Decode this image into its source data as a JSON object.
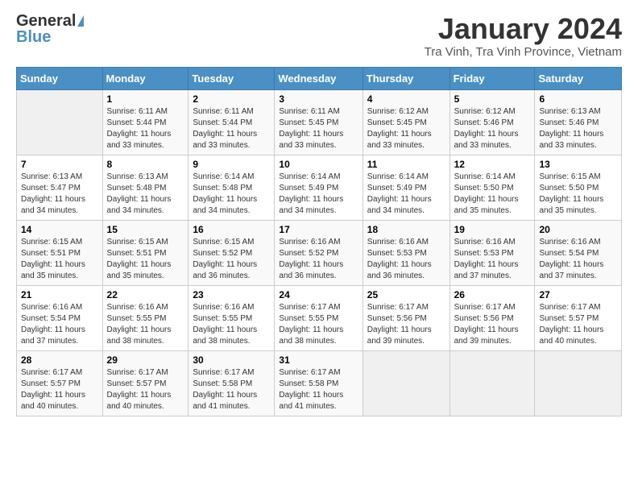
{
  "header": {
    "logo_general": "General",
    "logo_blue": "Blue",
    "title": "January 2024",
    "subtitle": "Tra Vinh, Tra Vinh Province, Vietnam"
  },
  "days_of_week": [
    "Sunday",
    "Monday",
    "Tuesday",
    "Wednesday",
    "Thursday",
    "Friday",
    "Saturday"
  ],
  "weeks": [
    [
      {
        "num": "",
        "sunrise": "",
        "sunset": "",
        "daylight": ""
      },
      {
        "num": "1",
        "sunrise": "Sunrise: 6:11 AM",
        "sunset": "Sunset: 5:44 PM",
        "daylight": "Daylight: 11 hours and 33 minutes."
      },
      {
        "num": "2",
        "sunrise": "Sunrise: 6:11 AM",
        "sunset": "Sunset: 5:44 PM",
        "daylight": "Daylight: 11 hours and 33 minutes."
      },
      {
        "num": "3",
        "sunrise": "Sunrise: 6:11 AM",
        "sunset": "Sunset: 5:45 PM",
        "daylight": "Daylight: 11 hours and 33 minutes."
      },
      {
        "num": "4",
        "sunrise": "Sunrise: 6:12 AM",
        "sunset": "Sunset: 5:45 PM",
        "daylight": "Daylight: 11 hours and 33 minutes."
      },
      {
        "num": "5",
        "sunrise": "Sunrise: 6:12 AM",
        "sunset": "Sunset: 5:46 PM",
        "daylight": "Daylight: 11 hours and 33 minutes."
      },
      {
        "num": "6",
        "sunrise": "Sunrise: 6:13 AM",
        "sunset": "Sunset: 5:46 PM",
        "daylight": "Daylight: 11 hours and 33 minutes."
      }
    ],
    [
      {
        "num": "7",
        "sunrise": "Sunrise: 6:13 AM",
        "sunset": "Sunset: 5:47 PM",
        "daylight": "Daylight: 11 hours and 34 minutes."
      },
      {
        "num": "8",
        "sunrise": "Sunrise: 6:13 AM",
        "sunset": "Sunset: 5:48 PM",
        "daylight": "Daylight: 11 hours and 34 minutes."
      },
      {
        "num": "9",
        "sunrise": "Sunrise: 6:14 AM",
        "sunset": "Sunset: 5:48 PM",
        "daylight": "Daylight: 11 hours and 34 minutes."
      },
      {
        "num": "10",
        "sunrise": "Sunrise: 6:14 AM",
        "sunset": "Sunset: 5:49 PM",
        "daylight": "Daylight: 11 hours and 34 minutes."
      },
      {
        "num": "11",
        "sunrise": "Sunrise: 6:14 AM",
        "sunset": "Sunset: 5:49 PM",
        "daylight": "Daylight: 11 hours and 34 minutes."
      },
      {
        "num": "12",
        "sunrise": "Sunrise: 6:14 AM",
        "sunset": "Sunset: 5:50 PM",
        "daylight": "Daylight: 11 hours and 35 minutes."
      },
      {
        "num": "13",
        "sunrise": "Sunrise: 6:15 AM",
        "sunset": "Sunset: 5:50 PM",
        "daylight": "Daylight: 11 hours and 35 minutes."
      }
    ],
    [
      {
        "num": "14",
        "sunrise": "Sunrise: 6:15 AM",
        "sunset": "Sunset: 5:51 PM",
        "daylight": "Daylight: 11 hours and 35 minutes."
      },
      {
        "num": "15",
        "sunrise": "Sunrise: 6:15 AM",
        "sunset": "Sunset: 5:51 PM",
        "daylight": "Daylight: 11 hours and 35 minutes."
      },
      {
        "num": "16",
        "sunrise": "Sunrise: 6:15 AM",
        "sunset": "Sunset: 5:52 PM",
        "daylight": "Daylight: 11 hours and 36 minutes."
      },
      {
        "num": "17",
        "sunrise": "Sunrise: 6:16 AM",
        "sunset": "Sunset: 5:52 PM",
        "daylight": "Daylight: 11 hours and 36 minutes."
      },
      {
        "num": "18",
        "sunrise": "Sunrise: 6:16 AM",
        "sunset": "Sunset: 5:53 PM",
        "daylight": "Daylight: 11 hours and 36 minutes."
      },
      {
        "num": "19",
        "sunrise": "Sunrise: 6:16 AM",
        "sunset": "Sunset: 5:53 PM",
        "daylight": "Daylight: 11 hours and 37 minutes."
      },
      {
        "num": "20",
        "sunrise": "Sunrise: 6:16 AM",
        "sunset": "Sunset: 5:54 PM",
        "daylight": "Daylight: 11 hours and 37 minutes."
      }
    ],
    [
      {
        "num": "21",
        "sunrise": "Sunrise: 6:16 AM",
        "sunset": "Sunset: 5:54 PM",
        "daylight": "Daylight: 11 hours and 37 minutes."
      },
      {
        "num": "22",
        "sunrise": "Sunrise: 6:16 AM",
        "sunset": "Sunset: 5:55 PM",
        "daylight": "Daylight: 11 hours and 38 minutes."
      },
      {
        "num": "23",
        "sunrise": "Sunrise: 6:16 AM",
        "sunset": "Sunset: 5:55 PM",
        "daylight": "Daylight: 11 hours and 38 minutes."
      },
      {
        "num": "24",
        "sunrise": "Sunrise: 6:17 AM",
        "sunset": "Sunset: 5:55 PM",
        "daylight": "Daylight: 11 hours and 38 minutes."
      },
      {
        "num": "25",
        "sunrise": "Sunrise: 6:17 AM",
        "sunset": "Sunset: 5:56 PM",
        "daylight": "Daylight: 11 hours and 39 minutes."
      },
      {
        "num": "26",
        "sunrise": "Sunrise: 6:17 AM",
        "sunset": "Sunset: 5:56 PM",
        "daylight": "Daylight: 11 hours and 39 minutes."
      },
      {
        "num": "27",
        "sunrise": "Sunrise: 6:17 AM",
        "sunset": "Sunset: 5:57 PM",
        "daylight": "Daylight: 11 hours and 40 minutes."
      }
    ],
    [
      {
        "num": "28",
        "sunrise": "Sunrise: 6:17 AM",
        "sunset": "Sunset: 5:57 PM",
        "daylight": "Daylight: 11 hours and 40 minutes."
      },
      {
        "num": "29",
        "sunrise": "Sunrise: 6:17 AM",
        "sunset": "Sunset: 5:57 PM",
        "daylight": "Daylight: 11 hours and 40 minutes."
      },
      {
        "num": "30",
        "sunrise": "Sunrise: 6:17 AM",
        "sunset": "Sunset: 5:58 PM",
        "daylight": "Daylight: 11 hours and 41 minutes."
      },
      {
        "num": "31",
        "sunrise": "Sunrise: 6:17 AM",
        "sunset": "Sunset: 5:58 PM",
        "daylight": "Daylight: 11 hours and 41 minutes."
      },
      {
        "num": "",
        "sunrise": "",
        "sunset": "",
        "daylight": ""
      },
      {
        "num": "",
        "sunrise": "",
        "sunset": "",
        "daylight": ""
      },
      {
        "num": "",
        "sunrise": "",
        "sunset": "",
        "daylight": ""
      }
    ]
  ]
}
